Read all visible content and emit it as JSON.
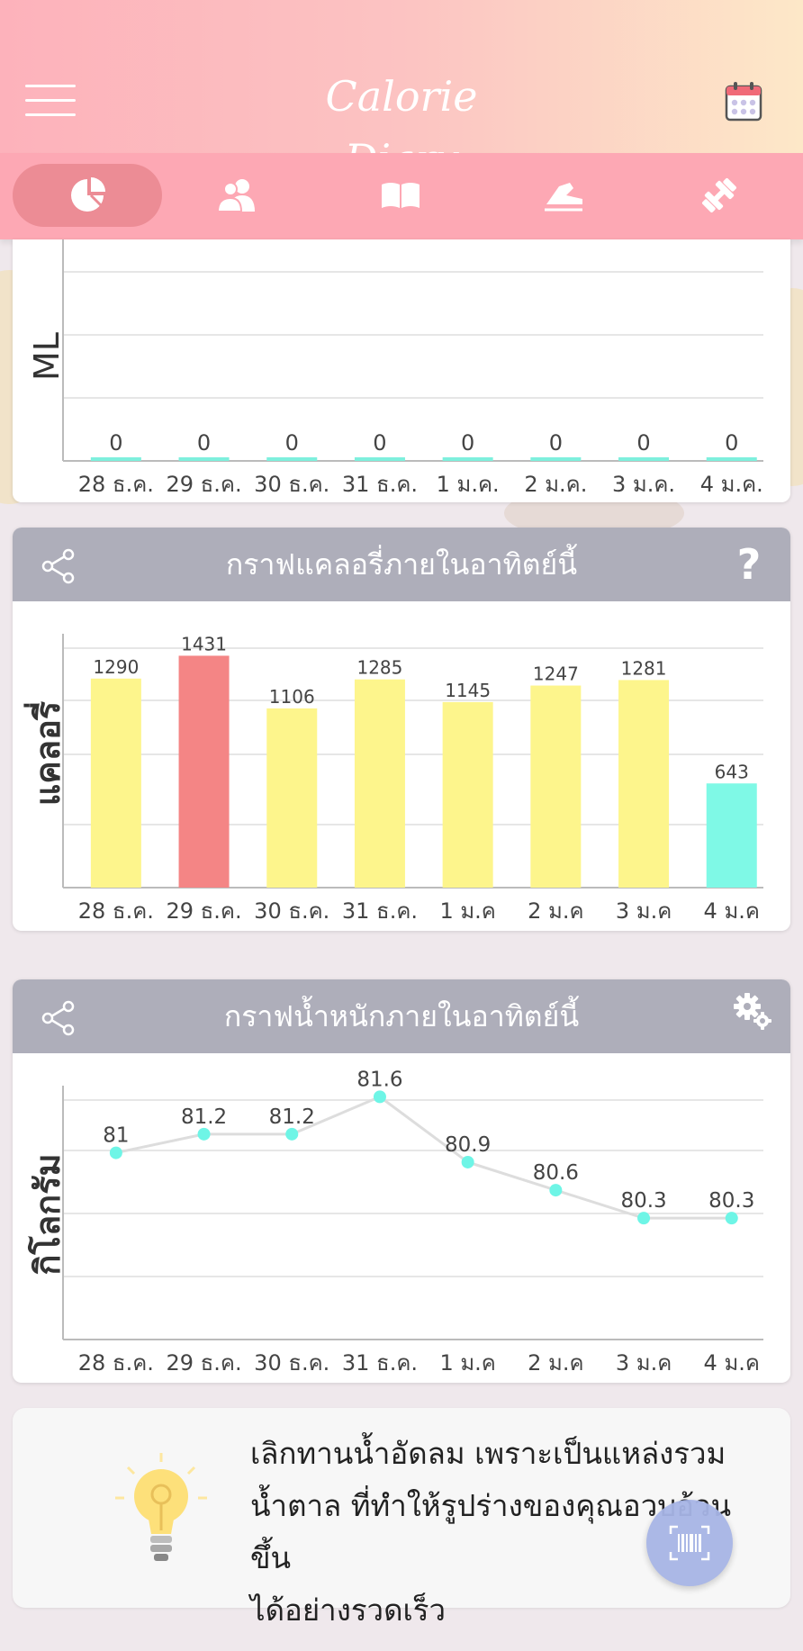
{
  "header": {
    "logo_text": "Calorie Diary"
  },
  "tabs": [
    {
      "icon": "pie-chart-icon",
      "active": true
    },
    {
      "icon": "users-icon",
      "active": false
    },
    {
      "icon": "book-icon",
      "active": false
    },
    {
      "icon": "shoe-icon",
      "active": false
    },
    {
      "icon": "dumbbell-icon",
      "active": false
    }
  ],
  "water_card": {
    "ylabel": "ML"
  },
  "calorie_card": {
    "title": "กราฟแคลอรี่ภายในอาทิตย์นี้",
    "ylabel": "แคลอรี่",
    "help_label": "?"
  },
  "weight_card": {
    "title": "กราฟน้ำหนักภายในอาทิตย์นี้",
    "ylabel": "กิโลกรัม"
  },
  "tip": {
    "lines": [
      "เลิกทานน้ำอัดลม เพราะเป็นแหล่งรวม",
      "น้ำตาล ที่ทำให้รูปร่างของคุณอวบอ้วนขึ้น",
      "ได้อย่างรวดเร็ว"
    ]
  },
  "colors": {
    "header_start": "#fdb2bb",
    "header_end": "#fde8c8",
    "tabbar": "#fda8b4",
    "card_head": "#aeaeba",
    "bar_yellow": "#fdf58c",
    "bar_red": "#f48585",
    "bar_cyan": "#7ff9e6",
    "water_bar": "#7ef0dd",
    "point_cyan": "#6ef5e6"
  },
  "chart_data": [
    {
      "type": "bar",
      "categories": [
        "28 ธ.ค.",
        "29 ธ.ค.",
        "30 ธ.ค.",
        "31 ธ.ค.",
        "1 ม.ค.",
        "2 ม.ค.",
        "3 ม.ค.",
        "4 ม.ค."
      ],
      "values": [
        0,
        0,
        0,
        0,
        0,
        0,
        0,
        0
      ],
      "ylabel": "ML",
      "grid": true
    },
    {
      "type": "bar",
      "categories": [
        "28 ธ.ค.",
        "29 ธ.ค.",
        "30 ธ.ค.",
        "31 ธ.ค.",
        "1 ม.ค",
        "2 ม.ค",
        "3 ม.ค",
        "4 ม.ค"
      ],
      "values": [
        1290,
        1431,
        1106,
        1285,
        1145,
        1247,
        1281,
        643
      ],
      "colors": [
        "#fdf58c",
        "#f48585",
        "#fdf58c",
        "#fdf58c",
        "#fdf58c",
        "#fdf58c",
        "#fdf58c",
        "#7ff9e6"
      ],
      "ylabel": "แคลอรี่",
      "ylim": [
        0,
        1600
      ],
      "grid": true
    },
    {
      "type": "line",
      "categories": [
        "28 ธ.ค.",
        "29 ธ.ค.",
        "30 ธ.ค.",
        "31 ธ.ค.",
        "1 ม.ค",
        "2 ม.ค",
        "3 ม.ค",
        "4 ม.ค"
      ],
      "values": [
        81,
        81.2,
        81.2,
        81.6,
        80.9,
        80.6,
        80.3,
        80.3
      ],
      "ylabel": "กิโลกรัม",
      "ylim": [
        79,
        81.7
      ],
      "grid": true
    }
  ]
}
